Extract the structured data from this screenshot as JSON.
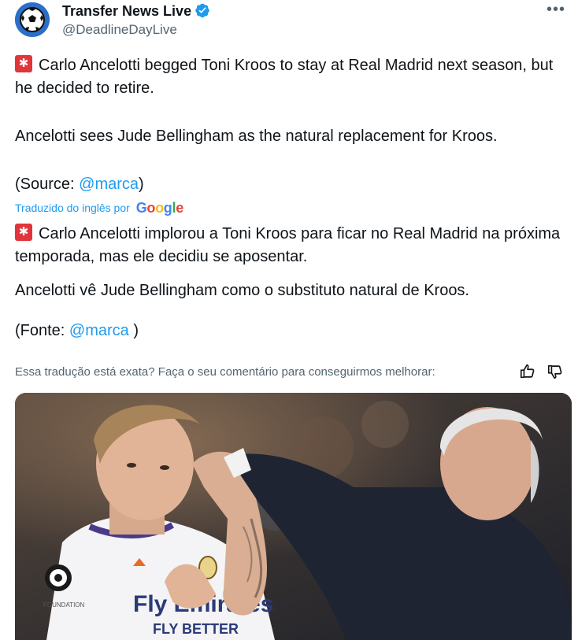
{
  "author": {
    "name": "Transfer News Live",
    "handle": "@DeadlineDayLive",
    "verified": true,
    "avatar_icon": "soccer-ball-icon"
  },
  "tweet": {
    "original_line1": "Carlo Ancelotti begged Toni Kroos to stay at Real Madrid next season, but he decided to retire.",
    "original_line2": "Ancelotti sees Jude Bellingham as the natural replacement for Kroos.",
    "original_source_prefix": "(Source: ",
    "original_source_link": "@marca",
    "original_source_suffix": ")",
    "translated_by": "Traduzido do inglês por",
    "translator_brand": "Google",
    "translated_line1": "Carlo Ancelotti implorou a Toni Kroos para ficar no Real Madrid na próxima temporada, mas ele decidiu se aposentar.",
    "translated_line2": "Ancelotti vê Jude Bellingham como o substituto natural de Kroos.",
    "translated_source_prefix": "(Fonte: ",
    "translated_source_link": "@marca",
    "translated_source_suffix": " )",
    "feedback_prompt": "Essa tradução está exata? Faça o seu comentário para conseguirmos melhorar:"
  },
  "media": {
    "jersey_text": "Fly Emirates",
    "jersey_text2": "FLY BETTER",
    "badge_text": "FOUNDATION"
  },
  "colors": {
    "link": "#1d9bf0",
    "secondary_text": "#536471",
    "siren": "#e0353a",
    "verified": "#1d9bf0"
  }
}
